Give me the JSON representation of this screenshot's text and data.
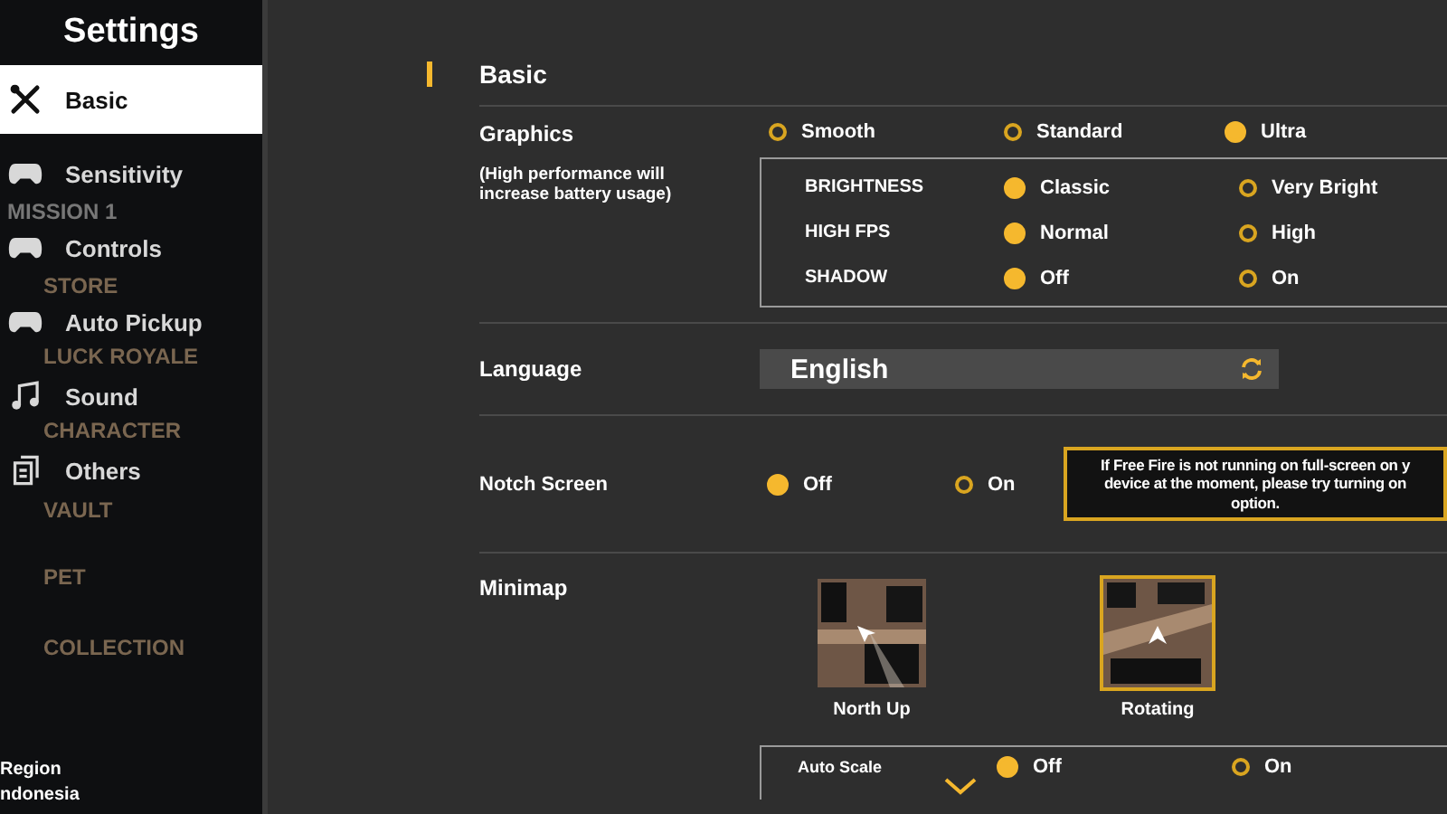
{
  "sidebar": {
    "title": "Settings",
    "items": [
      {
        "label": "Basic",
        "selected": true
      },
      {
        "label": "Sensitivity",
        "selected": false
      },
      {
        "label": "Controls",
        "selected": false
      },
      {
        "label": "Auto Pickup",
        "selected": false
      },
      {
        "label": "Sound",
        "selected": false
      },
      {
        "label": "Others",
        "selected": false
      }
    ],
    "backdrop_labels": [
      "MISSION 1",
      "STORE",
      "LUCK ROYALE",
      "CHARACTER",
      "VAULT",
      "PET",
      "COLLECTION"
    ],
    "region": {
      "label": "Region",
      "value": "ndonesia"
    }
  },
  "section_title": "Basic",
  "graphics": {
    "label": "Graphics",
    "note": "(High performance will increase battery usage)",
    "options": [
      {
        "label": "Smooth",
        "selected": false
      },
      {
        "label": "Standard",
        "selected": false
      },
      {
        "label": "Ultra",
        "selected": true
      }
    ],
    "details": [
      {
        "label": "BRIGHTNESS",
        "options": [
          {
            "label": "Classic",
            "selected": true
          },
          {
            "label": "Very Bright",
            "selected": false
          }
        ]
      },
      {
        "label": "HIGH FPS",
        "options": [
          {
            "label": "Normal",
            "selected": true
          },
          {
            "label": "High",
            "selected": false
          }
        ]
      },
      {
        "label": "SHADOW",
        "options": [
          {
            "label": "Off",
            "selected": true
          },
          {
            "label": "On",
            "selected": false
          }
        ]
      }
    ]
  },
  "language": {
    "label": "Language",
    "value": "English"
  },
  "notch_screen": {
    "label": "Notch Screen",
    "options": [
      {
        "label": "Off",
        "selected": true
      },
      {
        "label": "On",
        "selected": false
      }
    ],
    "tooltip": [
      "If Free Fire is not running on full-screen on y",
      "device at the moment, please try turning on",
      "option."
    ]
  },
  "minimap": {
    "label": "Minimap",
    "options": [
      {
        "label": "North Up",
        "selected": false
      },
      {
        "label": "Rotating",
        "selected": true
      }
    ],
    "auto_scale": {
      "label": "Auto Scale",
      "options": [
        {
          "label": "Off",
          "selected": true
        },
        {
          "label": "On",
          "selected": false
        }
      ]
    }
  }
}
